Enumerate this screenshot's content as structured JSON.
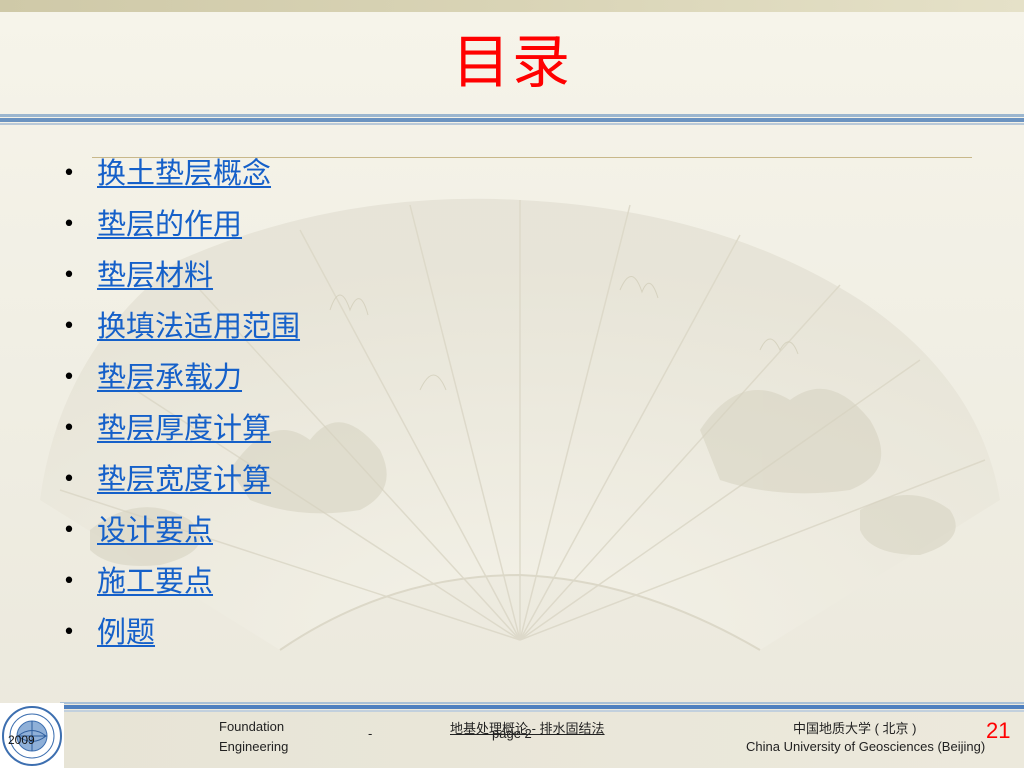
{
  "slide": {
    "title": "目录",
    "title_color": "#ff0000",
    "link_color": "#1560c9",
    "bullet_glyph": "•",
    "items": [
      {
        "label": "换土垫层概念"
      },
      {
        "label": "垫层的作用"
      },
      {
        "label": "垫层材料"
      },
      {
        "label": "换填法适用范围"
      },
      {
        "label": "垫层承载力"
      },
      {
        "label": "垫层厚度计算"
      },
      {
        "label": "垫层宽度计算"
      },
      {
        "label": "设计要点"
      },
      {
        "label": "施工要点"
      },
      {
        "label": "例题"
      }
    ]
  },
  "footer": {
    "year": "2009",
    "logo_icon": "university-seal-icon",
    "course_en_line1": "Foundation",
    "course_en_line2": "Engineering",
    "dash": "-",
    "course_cn": "地基处理概论 - 排水固结法",
    "page_label": "page 2",
    "university_cn": "中国地质大学 ( 北京 )",
    "university_en": "China University of Geosciences (Beijing)",
    "page_number": "21"
  }
}
